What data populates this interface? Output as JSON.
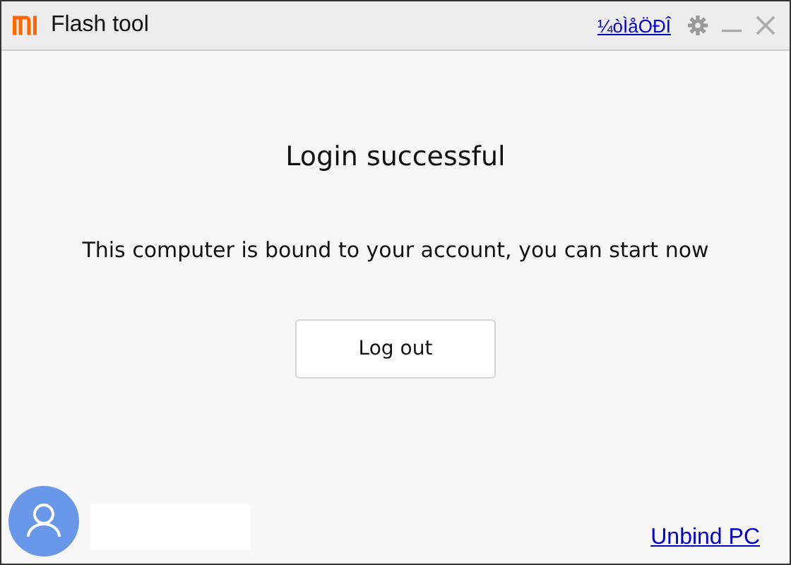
{
  "window": {
    "title": "Flash tool",
    "language_link": "¼òÌåÖÐÎ"
  },
  "content": {
    "heading": "Login successful",
    "message": "This computer is bound to your account, you can start now",
    "button": "Log out"
  },
  "footer": {
    "link": "Unbind PC"
  }
}
